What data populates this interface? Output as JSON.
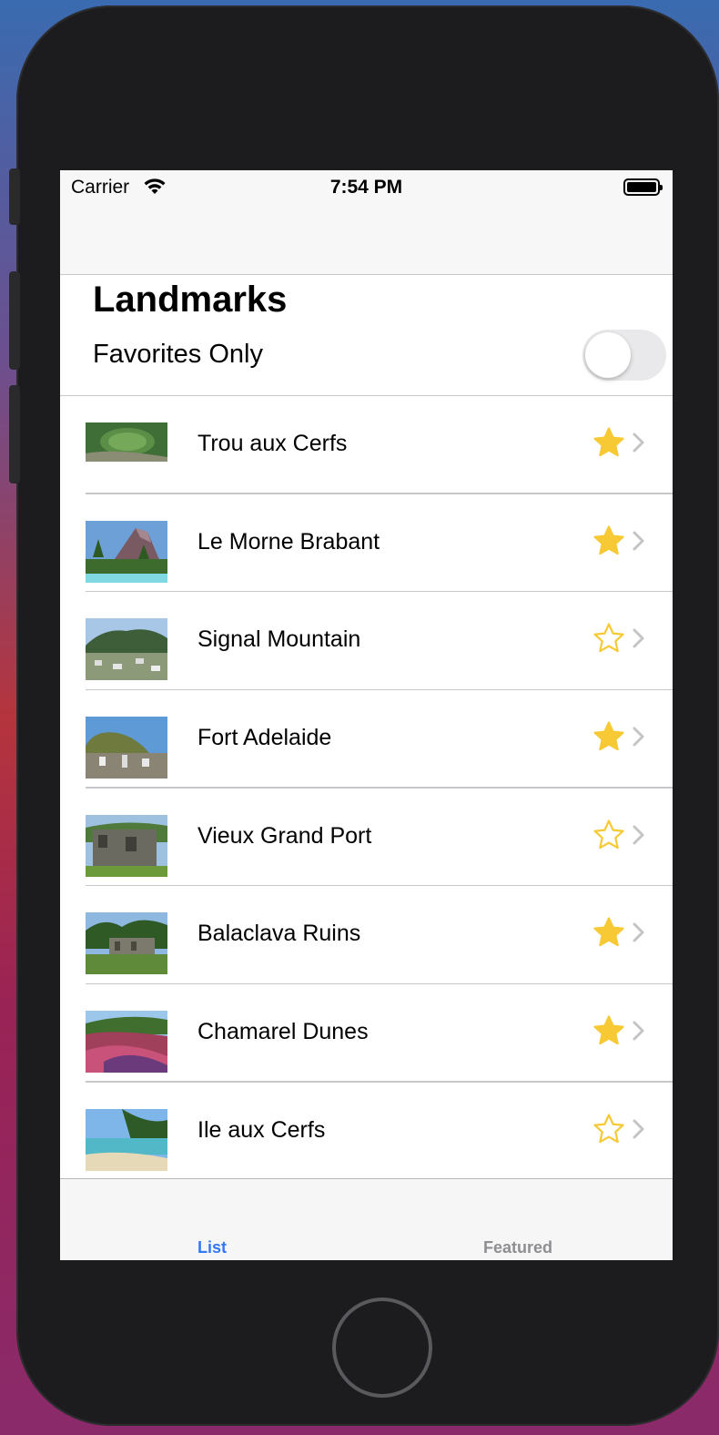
{
  "status_bar": {
    "carrier": "Carrier",
    "time": "7:54 PM"
  },
  "header": {
    "title": "Landmarks",
    "toggle_label": "Favorites Only",
    "toggle_on": false
  },
  "landmarks": [
    {
      "name": "Trou aux Cerfs",
      "favorite": true
    },
    {
      "name": "Le Morne Brabant",
      "favorite": true
    },
    {
      "name": "Signal Mountain",
      "favorite": false
    },
    {
      "name": "Fort Adelaide",
      "favorite": true
    },
    {
      "name": "Vieux Grand Port",
      "favorite": false
    },
    {
      "name": "Balaclava Ruins",
      "favorite": true
    },
    {
      "name": "Chamarel Dunes",
      "favorite": true
    },
    {
      "name": "Ile aux Cerfs",
      "favorite": false
    }
  ],
  "tabs": {
    "list": "List",
    "featured": "Featured",
    "selected": "List"
  },
  "colors": {
    "accent": "#3478f6",
    "star": "#f6c935",
    "separator": "#c8c7cc"
  }
}
